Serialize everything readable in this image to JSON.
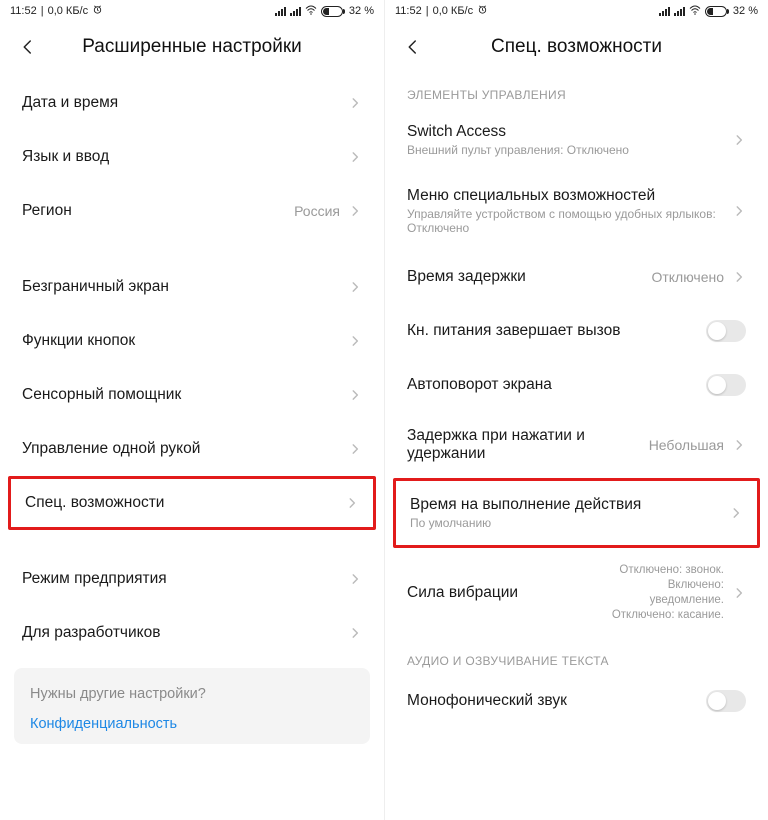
{
  "status": {
    "time": "11:52",
    "net": "0,0 КБ/с",
    "battery": "32 %"
  },
  "left": {
    "title": "Расширенные настройки",
    "rows": {
      "date": "Дата и время",
      "lang": "Язык и ввод",
      "region": "Регион",
      "region_value": "Россия",
      "fullscreen": "Безграничный экран",
      "buttons": "Функции кнопок",
      "assistant": "Сенсорный помощник",
      "onehand": "Управление одной рукой",
      "accessibility": "Спец. возможности",
      "enterprise": "Режим предприятия",
      "dev": "Для разработчиков"
    },
    "card": {
      "question": "Нужны другие настройки?",
      "link": "Конфиденциальность"
    }
  },
  "right": {
    "title": "Спец. возможности",
    "section1": "ЭЛЕМЕНТЫ УПРАВЛЕНИЯ",
    "switch_access": "Switch Access",
    "switch_access_sub": "Внешний пульт управления: Отключено",
    "menu": "Меню специальных возможностей",
    "menu_sub": "Управляйте устройством с помощью удобных ярлыков: Отключено",
    "delay": "Время задержки",
    "delay_value": "Отключено",
    "power": "Кн. питания завершает вызов",
    "rotate": "Автоповорот экрана",
    "touchhold": "Задержка при нажатии и удержании",
    "touchhold_value": "Небольшая",
    "action_time": "Время на выполнение действия",
    "action_time_sub": "По умолчанию",
    "vibration": "Сила вибрации",
    "vibration_value": "Отключено: звонок. Включено: уведомление. Отключено: касание.",
    "section2": "АУДИО И ОЗВУЧИВАНИЕ ТЕКСТА",
    "mono": "Монофонический звук"
  }
}
